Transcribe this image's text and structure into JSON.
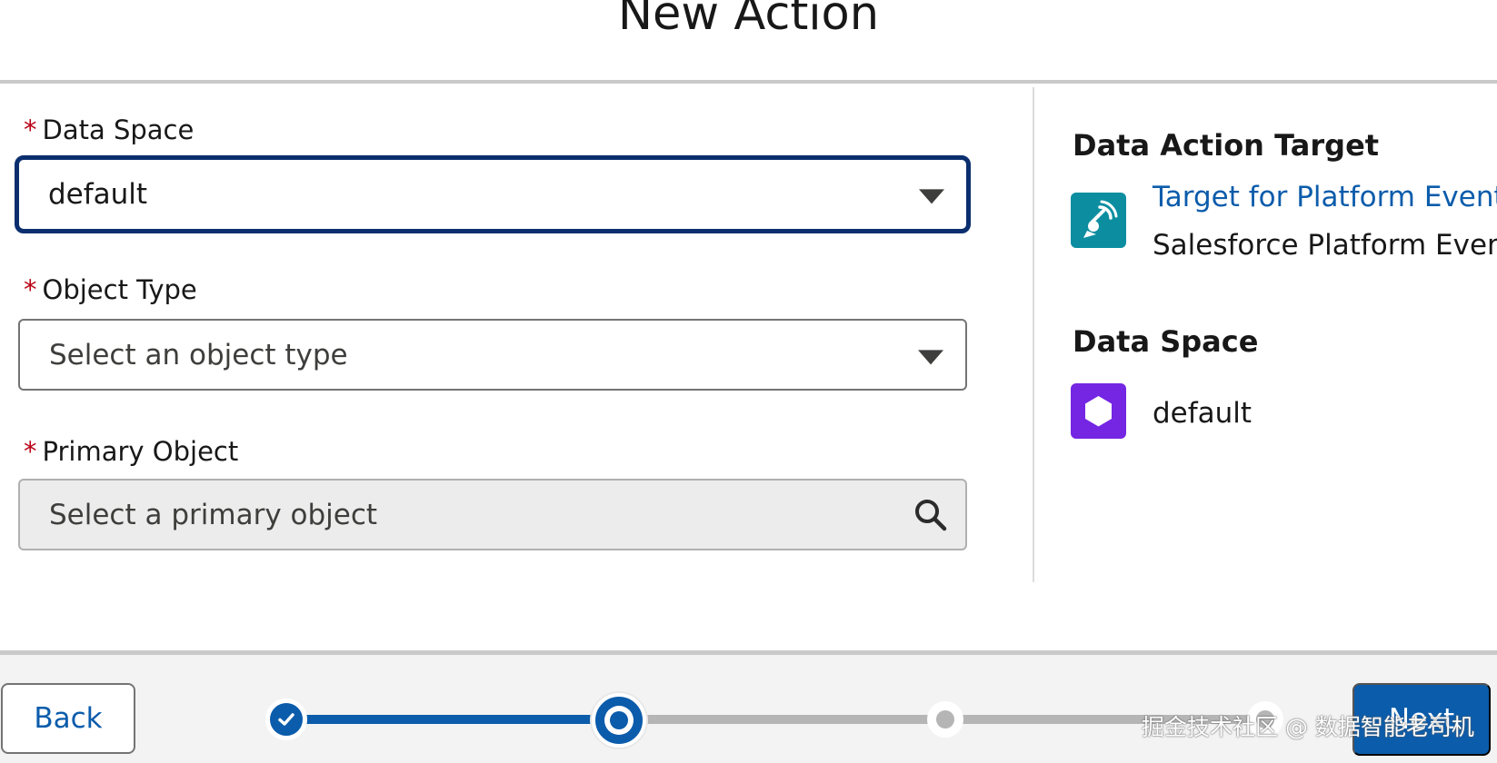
{
  "header": {
    "title": "New Action"
  },
  "form": {
    "data_space": {
      "label": "Data Space",
      "required_mark": "*",
      "value": "default"
    },
    "object_type": {
      "label": "Object Type",
      "required_mark": "*",
      "placeholder": "Select an object type"
    },
    "primary_object": {
      "label": "Primary Object",
      "required_mark": "*",
      "placeholder": "Select a primary object"
    }
  },
  "summary": {
    "target": {
      "heading": "Data Action Target",
      "name": "Target for Platform Event",
      "type": "Salesforce Platform Event",
      "icon": "platform-event-icon",
      "icon_color": "#0c8ea0"
    },
    "data_space": {
      "heading": "Data Space",
      "value": "default",
      "icon": "hexagon-icon",
      "icon_color": "#7526e3"
    }
  },
  "footer": {
    "back_label": "Back",
    "next_label": "Next",
    "progress": {
      "total_steps": 4,
      "current_step": 2,
      "completed_steps": 1
    }
  },
  "watermark": "掘金技术社区 @ 数据智能老司机",
  "colors": {
    "brand": "#0b5cab",
    "focus_border": "#0b2f6e",
    "required": "#ba0517"
  }
}
